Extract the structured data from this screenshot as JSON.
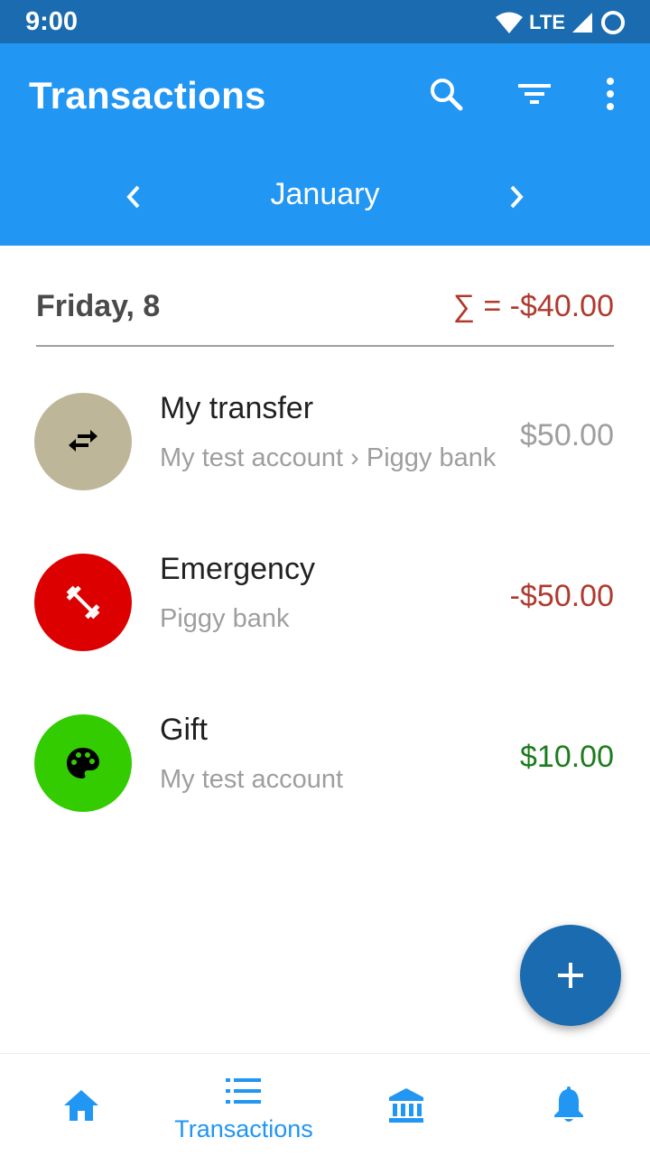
{
  "status_bar": {
    "time": "9:00",
    "network": "LTE"
  },
  "app_bar": {
    "title": "Transactions",
    "month": "January",
    "actions": [
      "search-icon",
      "filter-icon",
      "more-vert-icon"
    ]
  },
  "date_group": {
    "label": "Friday, 8",
    "sum": "∑ = -$40.00"
  },
  "transactions": [
    {
      "title": "My transfer",
      "subtitle": "My test account › Piggy bank",
      "amount": "$50.00",
      "icon": "transfer-icon",
      "avatar_color": "#BDB699",
      "amount_color": "#9e9e9e"
    },
    {
      "title": "Emergency",
      "subtitle": "Piggy bank",
      "amount": "-$50.00",
      "icon": "dumbbell-icon",
      "avatar_color": "#DD0000",
      "amount_color": "#B03A2E"
    },
    {
      "title": "Gift",
      "subtitle": "My test account",
      "amount": "$10.00",
      "icon": "palette-icon",
      "avatar_color": "#33CC00",
      "amount_color": "#1B7D1B"
    }
  ],
  "bottom_nav": {
    "items": [
      {
        "icon": "home-icon",
        "label": ""
      },
      {
        "icon": "list-icon",
        "label": "Transactions"
      },
      {
        "icon": "bank-icon",
        "label": ""
      },
      {
        "icon": "bell-icon",
        "label": ""
      }
    ]
  },
  "colors": {
    "primary": "#2196F3",
    "primary_dark": "#1A6BB0",
    "negative": "#B03A2E",
    "positive": "#1B7D1B"
  }
}
